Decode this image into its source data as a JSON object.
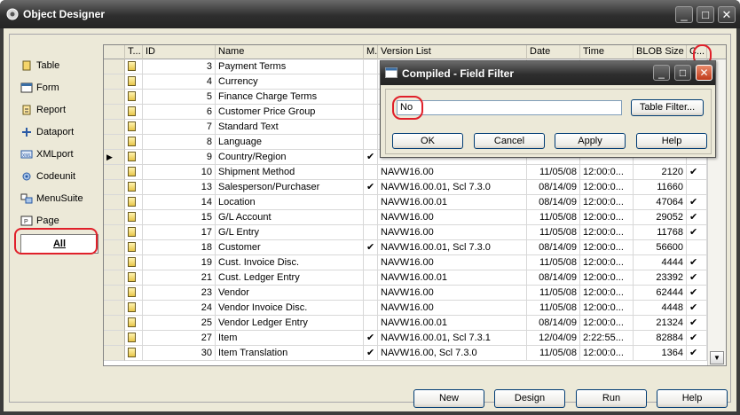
{
  "window": {
    "title": "Object Designer"
  },
  "sidebar": {
    "items": [
      {
        "label": "Table",
        "icon": "table-icon"
      },
      {
        "label": "Form",
        "icon": "form-icon"
      },
      {
        "label": "Report",
        "icon": "report-icon"
      },
      {
        "label": "Dataport",
        "icon": "dataport-icon"
      },
      {
        "label": "XMLport",
        "icon": "xmlport-icon"
      },
      {
        "label": "Codeunit",
        "icon": "codeunit-icon"
      },
      {
        "label": "MenuSuite",
        "icon": "menusuite-icon"
      },
      {
        "label": "Page",
        "icon": "page-icon"
      }
    ],
    "all_label": "All"
  },
  "grid": {
    "columns": [
      "T...",
      "ID",
      "Name",
      "M...",
      "Version List",
      "Date",
      "Time",
      "BLOB Size",
      "C..."
    ],
    "rows": [
      {
        "id": "3",
        "name": "Payment Terms",
        "m": "",
        "version": "",
        "date": "",
        "time": "",
        "blob": "",
        "c": ""
      },
      {
        "id": "4",
        "name": "Currency",
        "m": "",
        "version": "",
        "date": "",
        "time": "",
        "blob": "",
        "c": ""
      },
      {
        "id": "5",
        "name": "Finance Charge Terms",
        "m": "",
        "version": "",
        "date": "",
        "time": "",
        "blob": "",
        "c": ""
      },
      {
        "id": "6",
        "name": "Customer Price Group",
        "m": "",
        "version": "",
        "date": "",
        "time": "",
        "blob": "",
        "c": ""
      },
      {
        "id": "7",
        "name": "Standard Text",
        "m": "",
        "version": "",
        "date": "",
        "time": "",
        "blob": "",
        "c": ""
      },
      {
        "id": "8",
        "name": "Language",
        "m": "",
        "version": "",
        "date": "",
        "time": "",
        "blob": "",
        "c": ""
      },
      {
        "id": "9",
        "name": "Country/Region",
        "m": "✔",
        "version": "",
        "date": "",
        "time": "",
        "blob": "",
        "c": ""
      },
      {
        "id": "10",
        "name": "Shipment Method",
        "m": "",
        "version": "NAVW16.00",
        "date": "11/05/08",
        "time": "12:00:0...",
        "blob": "2120",
        "c": "✔"
      },
      {
        "id": "13",
        "name": "Salesperson/Purchaser",
        "m": "✔",
        "version": "NAVW16.00.01, Scl 7.3.0",
        "date": "08/14/09",
        "time": "12:00:0...",
        "blob": "11660",
        "c": ""
      },
      {
        "id": "14",
        "name": "Location",
        "m": "",
        "version": "NAVW16.00.01",
        "date": "08/14/09",
        "time": "12:00:0...",
        "blob": "47064",
        "c": "✔"
      },
      {
        "id": "15",
        "name": "G/L Account",
        "m": "",
        "version": "NAVW16.00",
        "date": "11/05/08",
        "time": "12:00:0...",
        "blob": "29052",
        "c": "✔"
      },
      {
        "id": "17",
        "name": "G/L Entry",
        "m": "",
        "version": "NAVW16.00",
        "date": "11/05/08",
        "time": "12:00:0...",
        "blob": "11768",
        "c": "✔"
      },
      {
        "id": "18",
        "name": "Customer",
        "m": "✔",
        "version": "NAVW16.00.01, Scl 7.3.0",
        "date": "08/14/09",
        "time": "12:00:0...",
        "blob": "56600",
        "c": ""
      },
      {
        "id": "19",
        "name": "Cust. Invoice Disc.",
        "m": "",
        "version": "NAVW16.00",
        "date": "11/05/08",
        "time": "12:00:0...",
        "blob": "4444",
        "c": "✔"
      },
      {
        "id": "21",
        "name": "Cust. Ledger Entry",
        "m": "",
        "version": "NAVW16.00.01",
        "date": "08/14/09",
        "time": "12:00:0...",
        "blob": "23392",
        "c": "✔"
      },
      {
        "id": "23",
        "name": "Vendor",
        "m": "",
        "version": "NAVW16.00",
        "date": "11/05/08",
        "time": "12:00:0...",
        "blob": "62444",
        "c": "✔"
      },
      {
        "id": "24",
        "name": "Vendor Invoice Disc.",
        "m": "",
        "version": "NAVW16.00",
        "date": "11/05/08",
        "time": "12:00:0...",
        "blob": "4448",
        "c": "✔"
      },
      {
        "id": "25",
        "name": "Vendor Ledger Entry",
        "m": "",
        "version": "NAVW16.00.01",
        "date": "08/14/09",
        "time": "12:00:0...",
        "blob": "21324",
        "c": "✔"
      },
      {
        "id": "27",
        "name": "Item",
        "m": "✔",
        "version": "NAVW16.00.01, Scl 7.3.1",
        "date": "12/04/09",
        "time": "2:22:55...",
        "blob": "82884",
        "c": "✔"
      },
      {
        "id": "30",
        "name": "Item Translation",
        "m": "✔",
        "version": "NAVW16.00, Scl 7.3.0",
        "date": "11/05/08",
        "time": "12:00:0...",
        "blob": "1364",
        "c": "✔"
      }
    ],
    "current_row_index": 6
  },
  "buttons": {
    "new": "New",
    "design": "Design",
    "run": "Run",
    "help": "Help"
  },
  "dialog": {
    "title": "Compiled - Field Filter",
    "filter_value": "No",
    "table_filter": "Table Filter...",
    "ok": "OK",
    "cancel": "Cancel",
    "apply": "Apply",
    "help": "Help"
  },
  "colors": {
    "highlight_ring": "#e0202a",
    "titlebar": "#2e2e2e",
    "face": "#ece9d8"
  }
}
